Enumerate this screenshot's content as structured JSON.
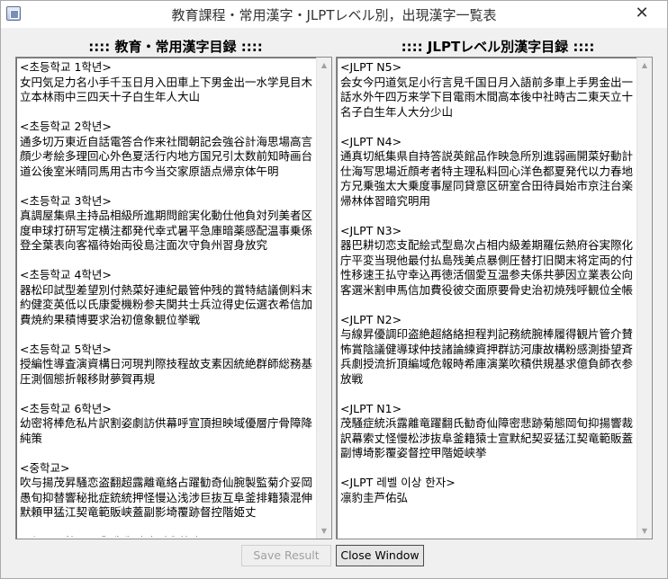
{
  "window": {
    "title": "教育課程・常用漢字・JLPTレベル別，出現漢字一覧表",
    "close_glyph": "✕"
  },
  "left_panel": {
    "title": ":::: 教育・常用漢字目録 ::::",
    "content": "<초등학교 1학년>\n女円気足力名小手千玉日月入田車上下男金出一水学見目木立本林雨中三四天十子白生年人大山\n\n<초등학교 2학년>\n通多切万東近自話電答合作来社間朝記会強谷計海思場高言顔少考絵多理回心外色夏活行内地方国兄引太数前知時画台道公後室米晴同馬用古市今当交家原語点帰京体午明\n\n<초등학교 3학년>\n真調屋集県主持品相級所進期問館実化動仕他負対列美者区度申球打研写定横注都発代幸式暑平急庫暗薬感配温事乗係登全葉表向客福待始両役島注面次守負州習身放究\n\n<초등학교 4학년>\n器松印試型差望別付熱菜好連紀最管仲残的賞特結議側料末約健変英低以氏康愛機粉参夫関共士兵泣得史伝選衣希信加費焼約果積博要求治初億象観位挙戦\n\n<초등학교 5학년>\n授編性導査演資構日河現判際技程故支素因統絶群師総務基圧測個態折報移財夢賀再規\n\n<초등학교 6학년>\n幼密将棒危私片訳割姿劇訪供幕呼宣頂担映域優層庁骨障降純策\n\n<중학교>\n吹与揚茂昇騒恋盗翻超露離竜絡占躍勧奇仙腕製監菊介妥岡愚旬抑替響秘批症銃統押怪慢込浅涉巨抜互阜釜排籍猿混伸默頼甲猛江契竜範販峡蓋副影埼覆跡督控階姫丈\n\n<초등/중학교 교육레벨 이상 상용한자>"
  },
  "right_panel": {
    "title": ":::: JLPTレベル別漢字目録 ::::",
    "content": "<JLPT N5>\n会女今円道気足小行言見千国日月入語前多車上手男金出一話水外午四万来学下目電雨木間高本後中社時古二東天立十名子白生年人大分少山\n\n<JLPT N4>\n通真切紙集県自持答説英館品作映急所別進弱画開菜好動計仕海写思場近顔考者特主理私料回心洋色都夏発代以力春地方兄乗強太大乗度事屋同貸意区研室合田待員始市京注台楽帰林体習暗究明用\n\n<JLPT N3>\n器巴耕切恋支配絵式型島次占相内級差期羅伝熱府谷実際化庁平変当現他最付払島残美点暴側圧替打旧関末将定両的付性移速王払守幸込再徳活個愛互温参夫係共夢因立業表公向客選米割申馬信加費役彼交面原要骨史治初焼残呼観位全帳\n\n<JLPT N2>\n与線昇優調印盗絶超絡絡担程判記務統腕棒履得観片管介賛怖賞陰議健導球仲技諸論練資押群訪河康故構粉感測掛望斉兵劇授流折頂編域危報時希庫演業吹積供規基求億負師衣参放戦\n\n<JLPT N1>\n茂騒症統浜露離竜躍翻氏勧奇仙障密悲跡菊態岡旬抑揚響裁訳幕索丈怪慢松涉抜阜釜籍猿士宣默紀契妥猛江契竜範販蓋副博埼影覆姿督控甲階姫峡挙\n\n<JLPT 레벨 이상 한자>\n凛豹圭芦佑弘"
  },
  "buttons": {
    "save_label": "Save Result",
    "close_label": "Close Window"
  },
  "icons": {
    "scroll_up": "▲",
    "scroll_down": "▼"
  }
}
